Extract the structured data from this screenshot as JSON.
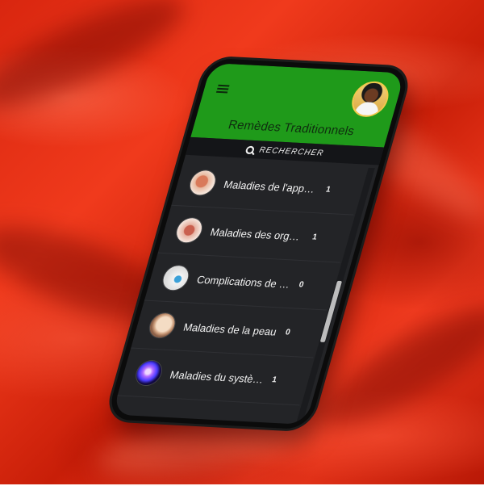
{
  "app": {
    "title": "Remèdes Traditionnels"
  },
  "header": {
    "menu_icon": "hamburger-menu-icon",
    "avatar_icon": "user-avatar"
  },
  "search": {
    "label": "RECHERCHER",
    "icon": "search-icon"
  },
  "colors": {
    "appbar": "#1f9a1a",
    "background": "#232427",
    "text": "#f2f2f2",
    "backdrop": "#e0301a"
  },
  "categories": [
    {
      "label": "Maladies de l'appareil digestif",
      "count": "1",
      "thumb": "digestive-icon"
    },
    {
      "label": "Maladies des organes génitaux",
      "count": "1",
      "thumb": "genital-organs-icon"
    },
    {
      "label": "Complications de la grossesse",
      "count": "0",
      "thumb": "pregnancy-icon"
    },
    {
      "label": "Maladies de la peau",
      "count": "0",
      "thumb": "skin-icon"
    },
    {
      "label": "Maladies du système nerveux",
      "count": "1",
      "thumb": "nervous-system-icon"
    }
  ]
}
